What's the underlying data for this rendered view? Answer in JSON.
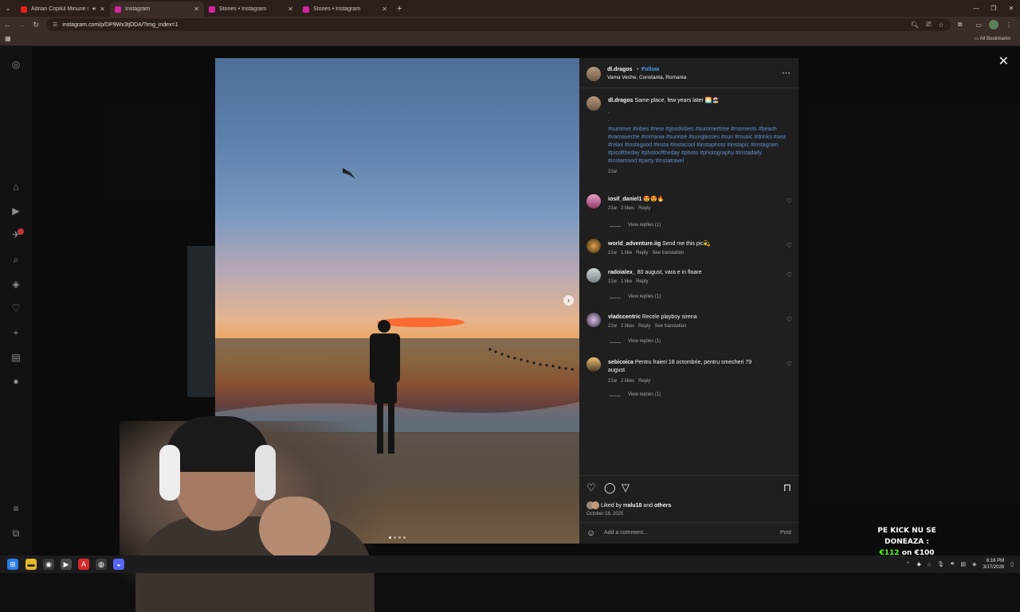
{
  "browser": {
    "tabs": [
      {
        "label": "Adrian Copilul Minune si Fl",
        "favicon_color": "#e62117",
        "active": false,
        "audio": true
      },
      {
        "label": "Instagram",
        "favicon_color": "#d6249f",
        "active": true,
        "audio": false
      },
      {
        "label": "Stories • Instagram",
        "favicon_color": "#d6249f",
        "active": false,
        "audio": false
      },
      {
        "label": "Stories • Instagram",
        "favicon_color": "#d6249f",
        "active": false,
        "audio": false
      }
    ],
    "url": "instagram.com/p/DP9Wx3tjDDA/?img_index=1",
    "all_bookmarks": "All Bookmarks"
  },
  "post": {
    "author": "dl.dragos",
    "follow_label": "Follow",
    "location": "Vama Veche, Constanta, Romania",
    "caption_user": "dl.dragos",
    "caption_text": "Same place, few years later 🌅🏖️",
    "caption_dots": ".\n.",
    "hashtags": "#summer #vibes #new #goodvibes #summertime #moments #beach #vamaveche #romania #sunrise #sunglasses #sun #music #drinks #sea #relax #instagood #insta #instacool #instaphoto #instapic #instagram #picoftheday #photooftheday #photo #photography #instadaily #instamood #party #instatravel",
    "caption_time": "21w",
    "liked_by_prefix": "Liked by",
    "liked_by_user": "rralu18",
    "liked_by_and": "and",
    "liked_by_others": "others",
    "date": "October 18, 2025",
    "add_comment_placeholder": "Add a comment...",
    "post_label": "Post",
    "dot_count": 4,
    "active_dot": 1
  },
  "comments": [
    {
      "user": "iosif_daniel1",
      "text": "😍😍🔥",
      "time": "21w",
      "likes": "2 likes",
      "reply": "Reply",
      "translate": "",
      "replies": "View replies (1)"
    },
    {
      "user": "world_adventure.iig",
      "text": "Send me this pic💫",
      "time": "21w",
      "likes": "1 like",
      "reply": "Reply",
      "translate": "See translation",
      "replies": ""
    },
    {
      "user": "radoialex_",
      "text": "80 august, vara e in floare",
      "time": "21w",
      "likes": "1 like",
      "reply": "Reply",
      "translate": "",
      "replies": "View replies (1)"
    },
    {
      "user": "vladccentric",
      "text": "Recele playboy sirena",
      "time": "21w",
      "likes": "2 likes",
      "reply": "Reply",
      "translate": "See translation",
      "replies": "View replies (1)"
    },
    {
      "user": "sebicoica",
      "text": "Pentru fraieri 18 octombrie, pentru smecheri 79 august",
      "time": "21w",
      "likes": "2 likes",
      "reply": "Reply",
      "translate": "",
      "replies": "View replies (1)"
    }
  ],
  "stream_overlay": {
    "line1": "PE KICK NU SE DONEAZA :",
    "amount1": "€112",
    "on": "on",
    "amount2": "€100"
  },
  "taskbar": {
    "time": "6:16 PM",
    "date": "3/17/2026"
  },
  "colors": {
    "accent_link": "#5f8ed8",
    "follow": "#4e9ef1",
    "kick_green": "#53fc18"
  }
}
